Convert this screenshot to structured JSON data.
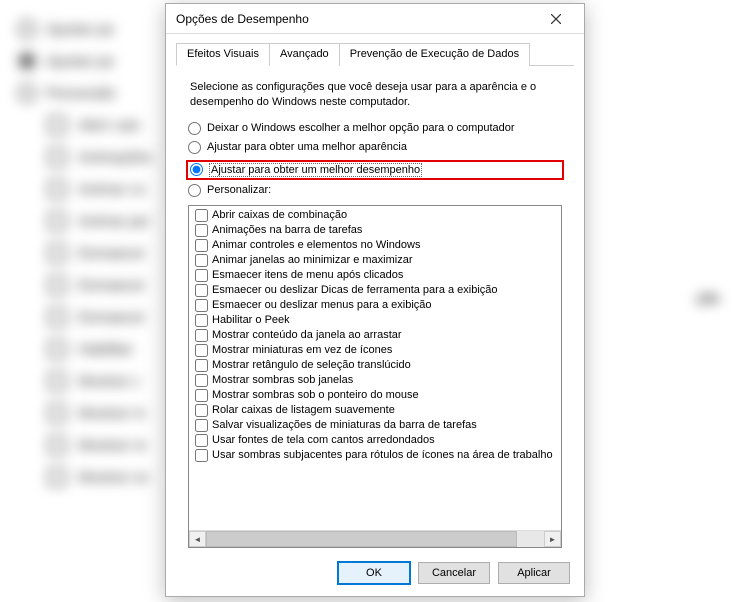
{
  "dialog": {
    "title": "Opções de Desempenho",
    "tabs": [
      {
        "label": "Efeitos Visuais",
        "active": true
      },
      {
        "label": "Avançado",
        "active": false
      },
      {
        "label": "Prevenção de Execução de Dados",
        "active": false
      }
    ],
    "instruction": "Selecione as configurações que você deseja usar para a aparência e o desempenho do Windows neste computador.",
    "radios": [
      {
        "label": "Deixar o Windows escolher a melhor opção para o computador",
        "selected": false,
        "highlight": false
      },
      {
        "label": "Ajustar para obter uma melhor aparência",
        "selected": false,
        "highlight": false
      },
      {
        "label": "Ajustar para obter um melhor desempenho",
        "selected": true,
        "highlight": true
      },
      {
        "label": "Personalizar:",
        "selected": false,
        "highlight": false
      }
    ],
    "effects": [
      "Abrir caixas de combinação",
      "Animações na barra de tarefas",
      "Animar controles e elementos no Windows",
      "Animar janelas ao minimizar e maximizar",
      "Esmaecer itens de menu após clicados",
      "Esmaecer ou deslizar Dicas de ferramenta para a exibição",
      "Esmaecer ou deslizar menus para a exibição",
      "Habilitar o Peek",
      "Mostrar conteúdo da janela ao arrastar",
      "Mostrar miniaturas em vez de ícones",
      "Mostrar retângulo de seleção translúcido",
      "Mostrar sombras sob janelas",
      "Mostrar sombras sob o ponteiro do mouse",
      "Rolar caixas de listagem suavemente",
      "Salvar visualizações de miniaturas da barra de tarefas",
      "Usar fontes de tela com cantos arredondados",
      "Usar sombras subjacentes para rótulos de ícones na área de trabalho"
    ],
    "buttons": {
      "ok": "OK",
      "cancel": "Cancelar",
      "apply": "Aplicar"
    }
  },
  "background": {
    "radios": [
      "Ajustar pa",
      "Ajustar pa",
      "Personaliz"
    ],
    "selectedIndex": 1,
    "checks": [
      "Abrir caix",
      "Animações",
      "Animar co",
      "Animar jan",
      "Esmaecer",
      "Esmaecer",
      "Esmaecer",
      "Habilitar",
      "Mostrar c",
      "Mostrar m",
      "Mostrar re",
      "Mostrar so"
    ],
    "rightText": "ção"
  }
}
